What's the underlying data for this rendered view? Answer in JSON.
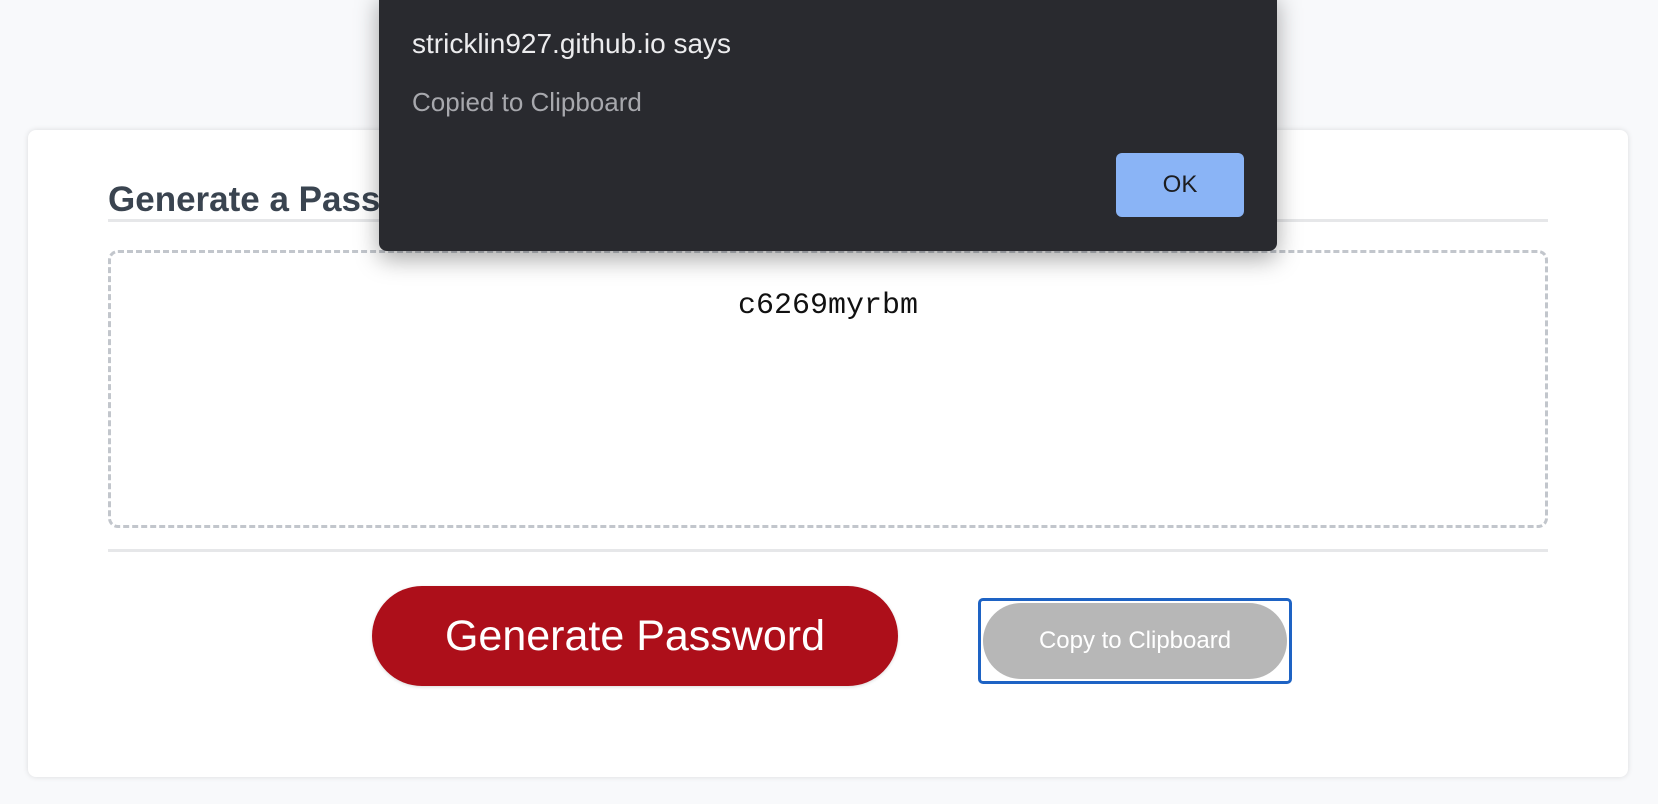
{
  "card": {
    "title": "Generate a Password"
  },
  "password": {
    "value": "c6269myrbm"
  },
  "buttons": {
    "generate_label": "Generate Password",
    "copy_label": "Copy to Clipboard"
  },
  "dialog": {
    "title": "stricklin927.github.io says",
    "message": "Copied to Clipboard",
    "ok_label": "OK"
  },
  "colors": {
    "page_background": "#f8f9fb",
    "generate_button": "#ad0f1a",
    "copy_button": "#b7b7b7",
    "focus_ring": "#1e63c4",
    "dialog_background": "#292a2f",
    "dialog_ok_button": "#8ab4f6"
  }
}
